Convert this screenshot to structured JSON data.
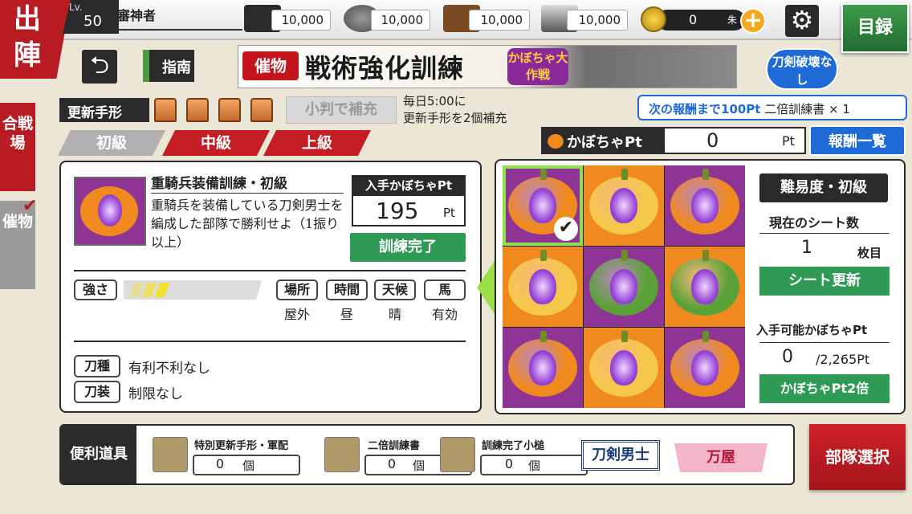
{
  "header": {
    "sortie_label": "出陣",
    "level_label": "Lv.",
    "level": "50",
    "player_name": "審神者",
    "resources": [
      {
        "icon": "charcoal-icon",
        "value": "10,000"
      },
      {
        "icon": "tamahagane-icon",
        "value": "10,000"
      },
      {
        "icon": "cooling-material-icon",
        "value": "10,000"
      },
      {
        "icon": "whetstone-icon",
        "value": "10,000"
      }
    ],
    "coins": "0",
    "coin_unit": "朱",
    "plus": "+",
    "gear": "⚙",
    "catalog": "目録"
  },
  "side_tabs": {
    "battlefield": "合戦場",
    "event": "催物",
    "check": "✔"
  },
  "nav": {
    "back": "⮌",
    "guide": "指南"
  },
  "banner": {
    "tag": "催物",
    "title": "戦術強化訓練",
    "sub": "かぼちゃ大作戦"
  },
  "no_break": "刀剣破壊なし",
  "renewal": {
    "label": "更新手形",
    "supplement": "小判で補充",
    "refill_line1": "毎日5:00に",
    "refill_line2": "更新手形を2個補充"
  },
  "next_reward": {
    "prefix": "次の報酬まで100Pt",
    "item": "二倍訓練書 × 1"
  },
  "difficulty": [
    "初級",
    "中級",
    "上級"
  ],
  "pumpkin_pt": {
    "label": "かぼちゃPt",
    "value": "0",
    "unit": "Pt",
    "reward_list": "報酬一覧"
  },
  "mission": {
    "title": "重騎兵装備訓練・初級",
    "desc": "重騎兵を装備している刀剣男士を編成した部隊で勝利せよ（1振り以上）",
    "earn_label": "入手かぼちゃPt",
    "earn_value": "195",
    "earn_unit": "Pt",
    "complete": "訓練完了",
    "strength_label": "強さ",
    "strength_level": 3,
    "strength_max": 10,
    "conditions": [
      {
        "head": "場所",
        "value": "屋外"
      },
      {
        "head": "時間",
        "value": "昼"
      },
      {
        "head": "天候",
        "value": "晴"
      },
      {
        "head": "馬",
        "value": "有効"
      }
    ],
    "sword_type_label": "刀種",
    "sword_type_value": "有利不利なし",
    "equip_label": "刀装",
    "equip_value": "制限なし"
  },
  "sheet": {
    "cells": [
      {
        "bg": "#8d3494",
        "pumpkin": "#f08a1e",
        "selected": true
      },
      {
        "bg": "#f08a1e",
        "pumpkin": "#f5c84a",
        "selected": false
      },
      {
        "bg": "#8d3494",
        "pumpkin": "#f08a1e",
        "selected": false
      },
      {
        "bg": "#f08a1e",
        "pumpkin": "#f5c84a",
        "selected": false
      },
      {
        "bg": "#8d3494",
        "pumpkin": "#5aa238",
        "selected": false
      },
      {
        "bg": "#f08a1e",
        "pumpkin": "#5aa238",
        "selected": false
      },
      {
        "bg": "#8d3494",
        "pumpkin": "#f08a1e",
        "selected": false
      },
      {
        "bg": "#f08a1e",
        "pumpkin": "#f5c84a",
        "selected": false
      },
      {
        "bg": "#8d3494",
        "pumpkin": "#f08a1e",
        "selected": false
      }
    ],
    "check": "✔",
    "level": "難易度・初級",
    "sheets_label": "現在のシート数",
    "sheets_value": "1",
    "sheets_unit": "枚目",
    "update": "シート更新",
    "avail_label": "入手可能かぼちゃPt",
    "avail_value": "0",
    "avail_total": "/2,265Pt",
    "double": "かぼちゃPt2倍"
  },
  "tools": {
    "label": "便利道具",
    "items": [
      {
        "name": "特別更新手形・軍配",
        "count": "0",
        "unit": "個"
      },
      {
        "name": "二倍訓練書",
        "count": "0",
        "unit": "個"
      },
      {
        "name": "訓練完了小槌",
        "count": "0",
        "unit": "個"
      }
    ],
    "swords": "刀剣男士",
    "shop": "万屋"
  },
  "squad_select": "部隊選択"
}
